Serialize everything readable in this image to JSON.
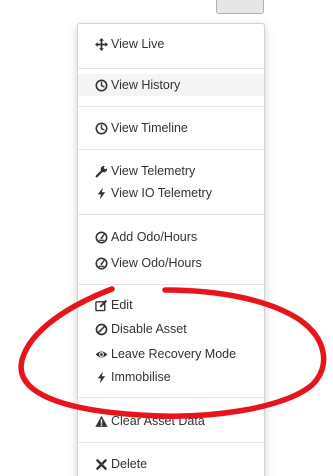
{
  "menu": {
    "items": [
      {
        "label": "View Live",
        "icon": "move-arrows-icon"
      },
      {
        "label": "View History",
        "icon": "clock-icon"
      },
      {
        "label": "View Timeline",
        "icon": "clock-icon"
      },
      {
        "label": "View Telemetry",
        "icon": "wrench-icon"
      },
      {
        "label": "View IO Telemetry",
        "icon": "lightning-bolt-icon"
      },
      {
        "label": "Add Odo/Hours",
        "icon": "dashboard-gauge-icon"
      },
      {
        "label": "View Odo/Hours",
        "icon": "dashboard-gauge-icon"
      },
      {
        "label": "Edit",
        "icon": "edit-icon"
      },
      {
        "label": "Disable Asset",
        "icon": "ban-icon"
      },
      {
        "label": "Leave Recovery Mode",
        "icon": "eye-icon"
      },
      {
        "label": "Immobilise",
        "icon": "lightning-bolt-icon"
      },
      {
        "label": "Clear Asset Data",
        "icon": "warning-triangle-icon"
      },
      {
        "label": "Delete",
        "icon": "cross-icon"
      }
    ]
  },
  "colors": {
    "menu_text": "#333333",
    "menu_icon": "#333333",
    "active_background": "#f5f5f5",
    "divider": "#e5e5e5",
    "annotation": "#e8141b"
  }
}
